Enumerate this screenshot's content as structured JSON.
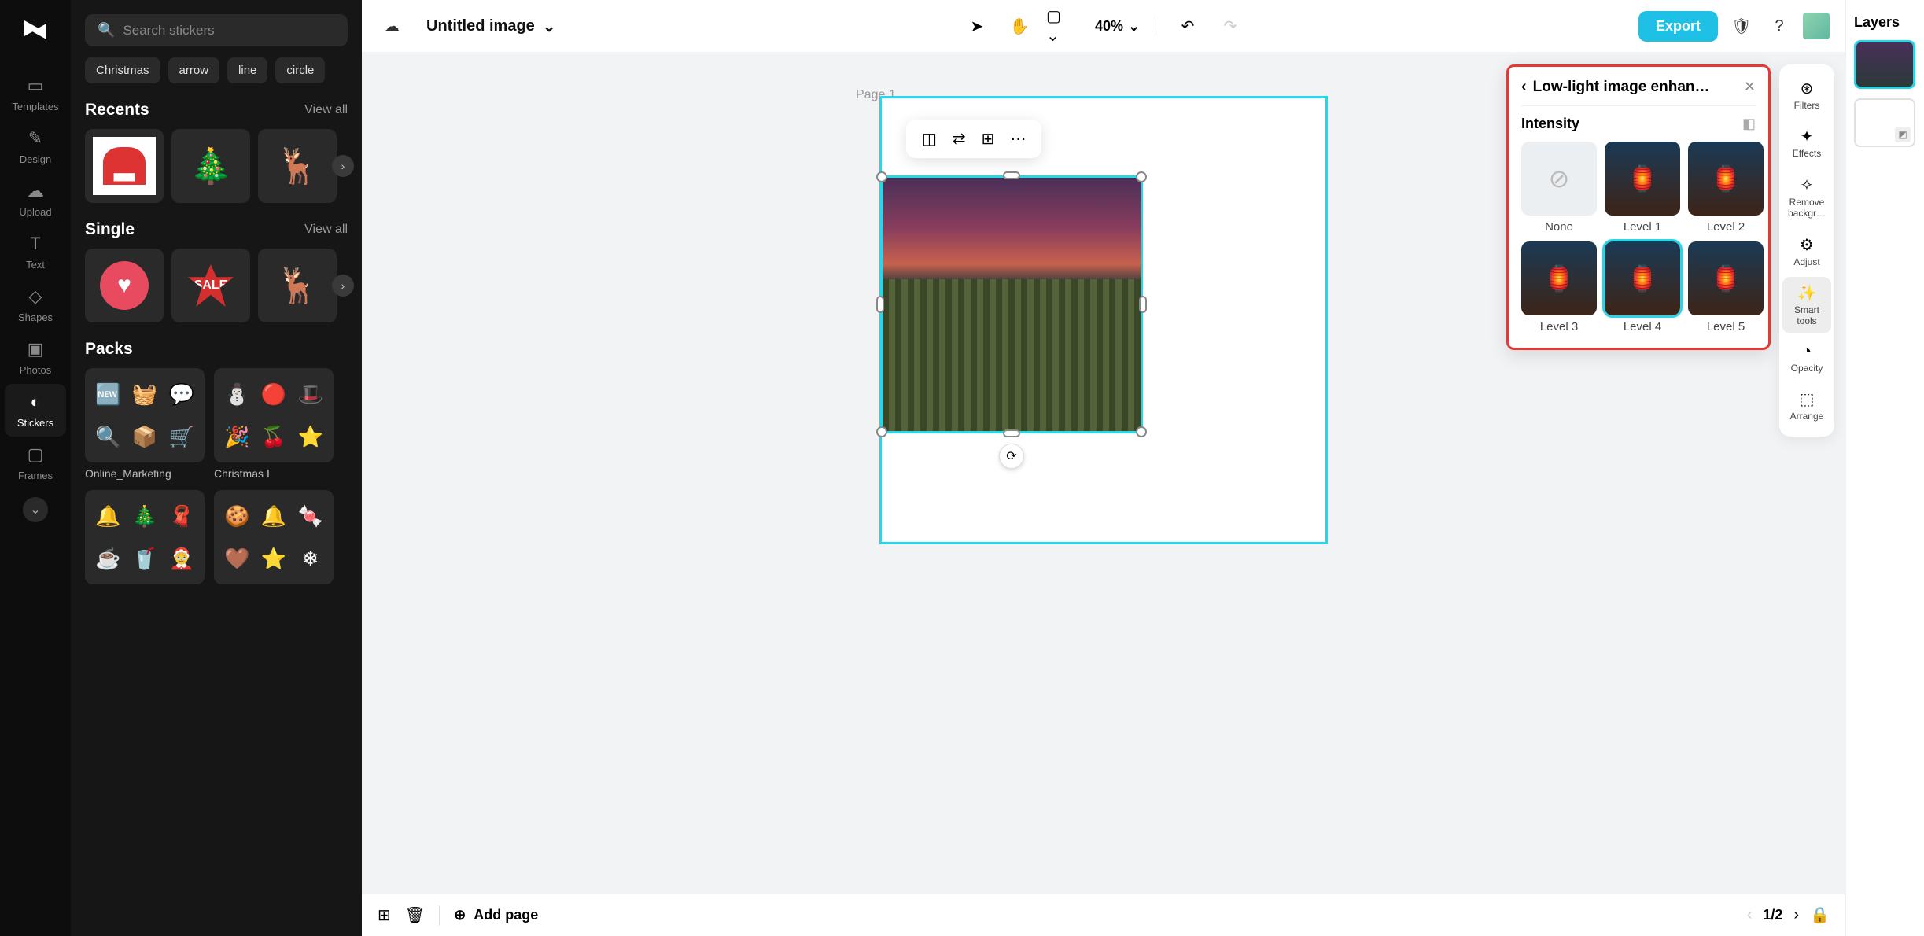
{
  "nav": {
    "items": [
      {
        "label": "Templates",
        "icon": "📑"
      },
      {
        "label": "Design",
        "icon": "✦"
      },
      {
        "label": "Upload",
        "icon": "☁"
      },
      {
        "label": "Text",
        "icon": "T"
      },
      {
        "label": "Shapes",
        "icon": "◇"
      },
      {
        "label": "Photos",
        "icon": "🖼"
      },
      {
        "label": "Stickers",
        "icon": "◐"
      },
      {
        "label": "Frames",
        "icon": "▢"
      }
    ],
    "active": "Stickers"
  },
  "search": {
    "placeholder": "Search stickers"
  },
  "tags": [
    "Christmas",
    "arrow",
    "line",
    "circle"
  ],
  "sections": {
    "recents": {
      "title": "Recents",
      "view_all": "View all",
      "items": [
        "🎅",
        "🎄",
        "🦌"
      ]
    },
    "single": {
      "title": "Single",
      "view_all": "View all",
      "items": [
        "❤️",
        "SALE",
        "🦌"
      ]
    },
    "packs": {
      "title": "Packs",
      "items": [
        {
          "name": "Online_Marketing",
          "emojis": [
            "🆕",
            "🧺",
            "💬",
            "🔍",
            "📦",
            "🛒"
          ]
        },
        {
          "name": "Christmas Ⅰ",
          "emojis": [
            "⛄",
            "🔴",
            "🎩",
            "🎉",
            "🍒",
            "⭐"
          ]
        }
      ]
    },
    "extra_row": [
      {
        "emojis": [
          "🔔",
          "🎄",
          "🧣",
          "☕",
          "🥤",
          "🤶"
        ]
      },
      {
        "emojis": [
          "🍪",
          "🔔",
          "🍬",
          "🤎",
          "⭐",
          "❄"
        ]
      }
    ]
  },
  "topbar": {
    "project_name": "Untitled image",
    "zoom": "40%",
    "export": "Export"
  },
  "canvas": {
    "page_label": "Page 1",
    "float_tools": [
      "crop",
      "replace",
      "group",
      "more"
    ]
  },
  "popup": {
    "title": "Low-light image enhan…",
    "section": "Intensity",
    "levels": [
      "None",
      "Level 1",
      "Level 2",
      "Level 3",
      "Level 4",
      "Level 5"
    ],
    "selected": "Level 4"
  },
  "tool_rail": [
    {
      "label": "Filters",
      "icon": "⊛"
    },
    {
      "label": "Effects",
      "icon": "✦"
    },
    {
      "label": "Remove backgr…",
      "icon": "✧"
    },
    {
      "label": "Adjust",
      "icon": "⚙"
    },
    {
      "label": "Smart tools",
      "icon": "✨"
    },
    {
      "label": "Opacity",
      "icon": "◔"
    },
    {
      "label": "Arrange",
      "icon": "⬚"
    }
  ],
  "tool_rail_active": "Smart tools",
  "bottom": {
    "add_page": "Add page",
    "page_indicator": "1/2"
  },
  "layers": {
    "title": "Layers"
  }
}
